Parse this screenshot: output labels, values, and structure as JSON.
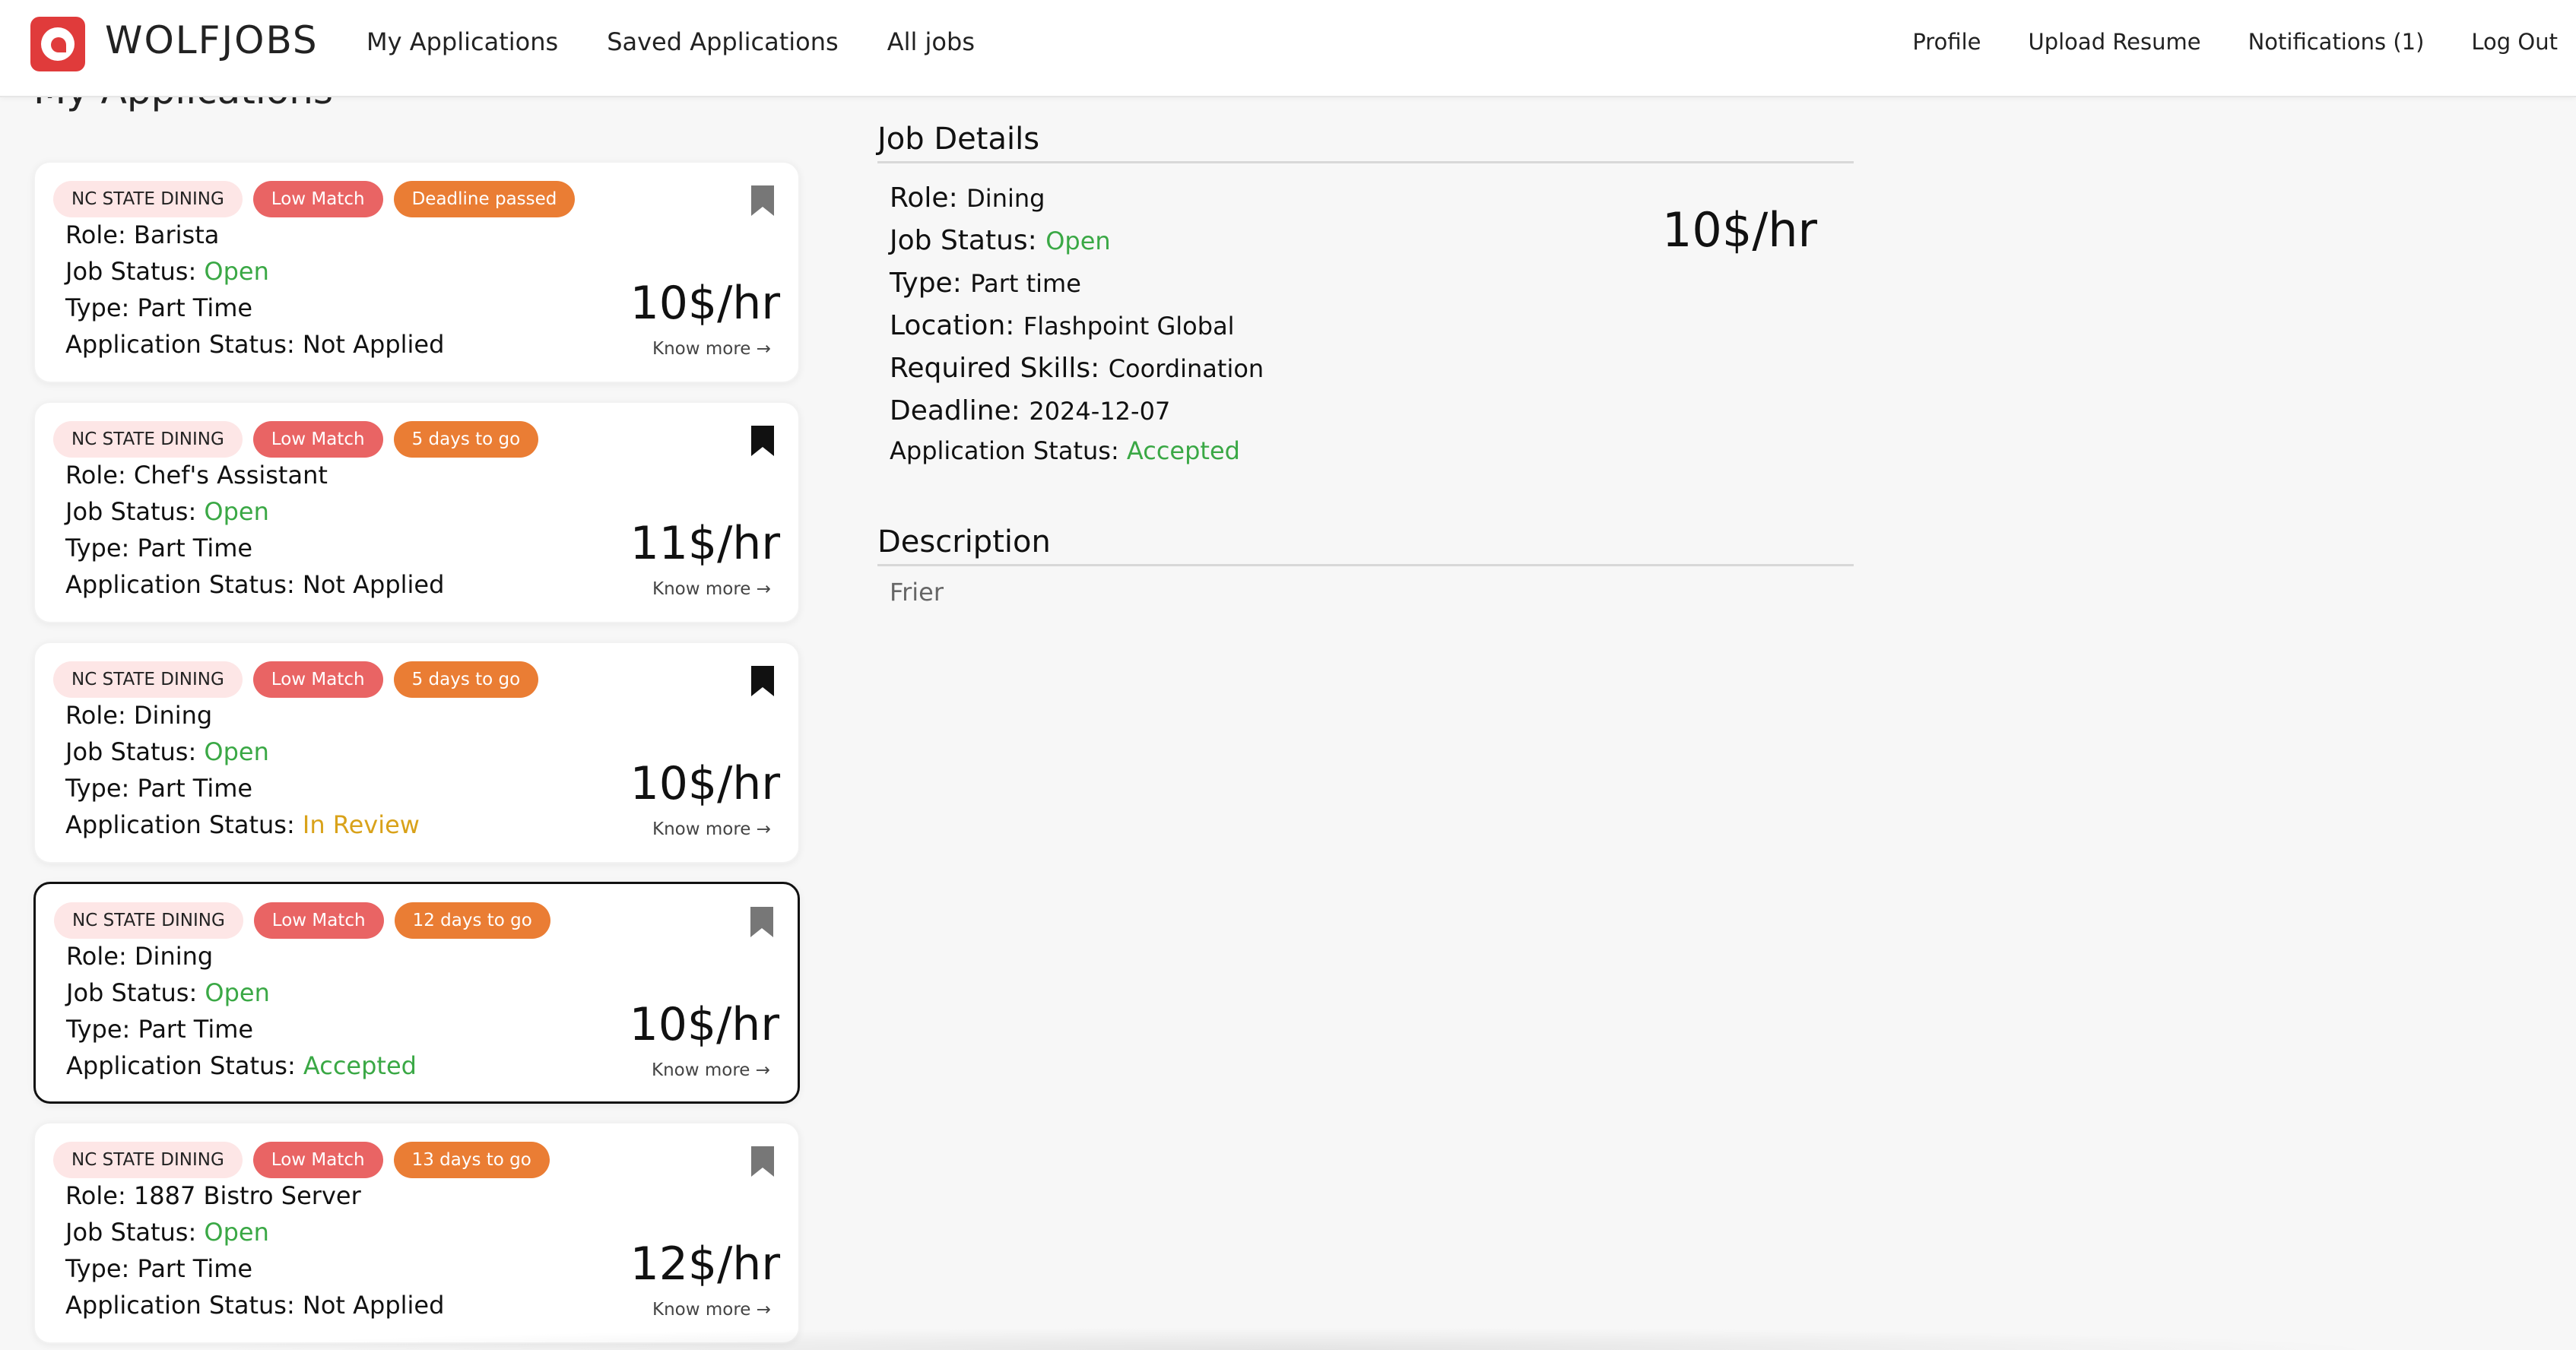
{
  "nav": {
    "brand": "WOLFJOBS",
    "left_links": [
      "My Applications",
      "Saved Applications",
      "All jobs"
    ],
    "right_links": [
      "Profile",
      "Upload Resume",
      "Notifications (1)",
      "Log Out"
    ]
  },
  "page_title": "My Applications",
  "cards": [
    {
      "company": "NC STATE DINING",
      "match": "Low Match",
      "deadline": "Deadline passed",
      "role_label": "Role: ",
      "role": "Barista",
      "job_status_label": "Job Status: ",
      "job_status": "Open",
      "type_label": "Type: ",
      "type": "Part Time",
      "app_status_label": "Application Status: ",
      "app_status": "Not Applied",
      "pay": "10$/hr",
      "know_more": "Know more →",
      "bookmarked": false
    },
    {
      "company": "NC STATE DINING",
      "match": "Low Match",
      "deadline": "5 days to go",
      "role_label": "Role: ",
      "role": "Chef's Assistant",
      "job_status_label": "Job Status: ",
      "job_status": "Open",
      "type_label": "Type: ",
      "type": "Part Time",
      "app_status_label": "Application Status: ",
      "app_status": "Not Applied",
      "pay": "11$/hr",
      "know_more": "Know more →",
      "bookmarked": true
    },
    {
      "company": "NC STATE DINING",
      "match": "Low Match",
      "deadline": "5 days to go",
      "role_label": "Role: ",
      "role": "Dining",
      "job_status_label": "Job Status: ",
      "job_status": "Open",
      "type_label": "Type: ",
      "type": "Part Time",
      "app_status_label": "Application Status: ",
      "app_status": "In Review",
      "pay": "10$/hr",
      "know_more": "Know more →",
      "bookmarked": true
    },
    {
      "company": "NC STATE DINING",
      "match": "Low Match",
      "deadline": "12 days to go",
      "role_label": "Role: ",
      "role": "Dining",
      "job_status_label": "Job Status: ",
      "job_status": "Open",
      "type_label": "Type: ",
      "type": "Part Time",
      "app_status_label": "Application Status: ",
      "app_status": "Accepted",
      "pay": "10$/hr",
      "know_more": "Know more →",
      "bookmarked": false
    },
    {
      "company": "NC STATE DINING",
      "match": "Low Match",
      "deadline": "13 days to go",
      "role_label": "Role: ",
      "role": "1887 Bistro Server",
      "job_status_label": "Job Status: ",
      "job_status": "Open",
      "type_label": "Type: ",
      "type": "Part Time",
      "app_status_label": "Application Status: ",
      "app_status": "Not Applied",
      "pay": "12$/hr",
      "know_more": "Know more →",
      "bookmarked": false
    }
  ],
  "details": {
    "title": "Job Details",
    "role_label": "Role: ",
    "role": "Dining",
    "job_status_label": "Job Status: ",
    "job_status": "Open",
    "type_label": "Type: ",
    "type": "Part time",
    "location_label": "Location: ",
    "location": "Flashpoint Global",
    "skills_label": "Required Skills: ",
    "skills": "Coordination",
    "deadline_label": "Deadline: ",
    "deadline": "2024-12-07",
    "app_status_label": "Application Status: ",
    "app_status": "Accepted",
    "pay": "10$/hr",
    "description_title": "Description",
    "description": "Frier"
  },
  "colors": {
    "brand_red": "#e03b3b",
    "match_badge": "#e96464",
    "deadline_badge": "#ea7d34",
    "company_badge": "#fde6e6",
    "status_green": "#3aa845",
    "status_review": "#d9a21a"
  }
}
